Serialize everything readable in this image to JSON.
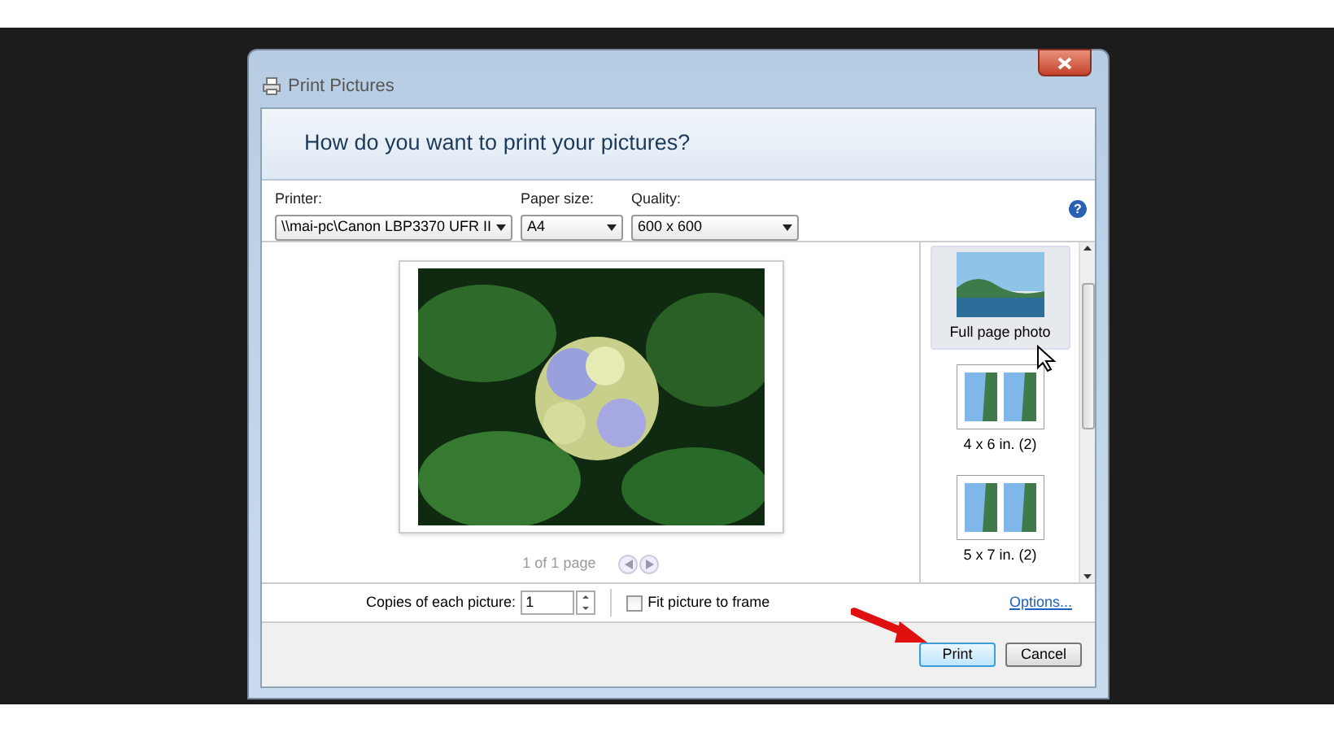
{
  "window": {
    "title": "Print Pictures"
  },
  "heading": "How do you want to print your pictures?",
  "printer": {
    "label": "Printer:",
    "value": "\\\\mai-pc\\Canon LBP3370 UFR II"
  },
  "paper_size": {
    "label": "Paper size:",
    "value": "A4"
  },
  "quality": {
    "label": "Quality:",
    "value": "600 x 600"
  },
  "help_button": "?",
  "preview": {
    "page_indicator": "1 of 1 page"
  },
  "layouts": [
    {
      "label": "Full page photo",
      "kind": "full",
      "selected": true
    },
    {
      "label": "4 x 6 in. (2)",
      "kind": "pair",
      "selected": false
    },
    {
      "label": "5 x 7 in. (2)",
      "kind": "pair",
      "selected": false
    }
  ],
  "copies": {
    "label": "Copies of each picture:",
    "value": "1"
  },
  "fit_to_frame": {
    "label": "Fit picture to frame",
    "checked": false
  },
  "options_link": "Options...",
  "buttons": [
    {
      "label": "Print",
      "default": true
    },
    {
      "label": "Cancel",
      "default": false
    }
  ]
}
